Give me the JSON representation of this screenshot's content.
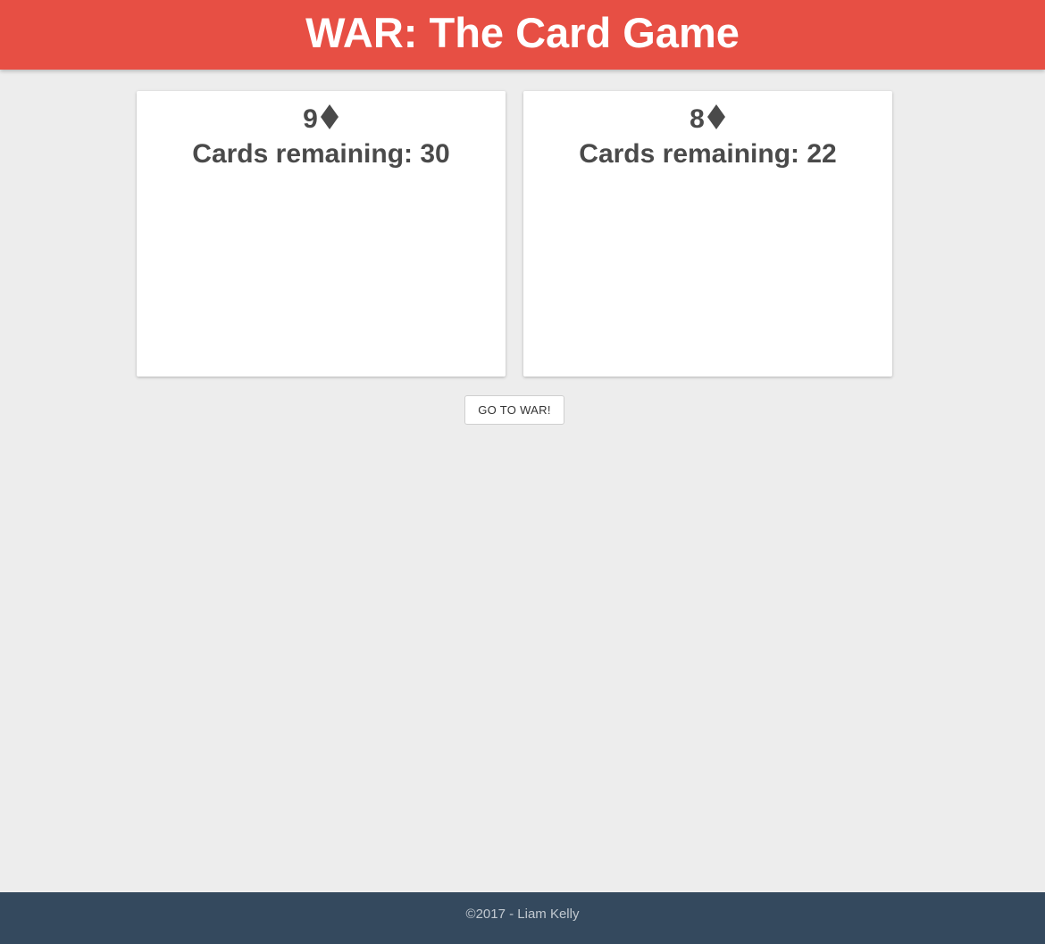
{
  "header": {
    "title": "WAR: The Card Game"
  },
  "players": [
    {
      "card_rank": "9",
      "card_suit": "diamond-icon",
      "remaining_text": "Cards remaining: 30"
    },
    {
      "card_rank": "8",
      "card_suit": "diamond-icon",
      "remaining_text": "Cards remaining: 22"
    }
  ],
  "actions": {
    "war_button_label": "GO TO WAR!"
  },
  "footer": {
    "copyright": "©2017 - Liam Kelly"
  },
  "colors": {
    "header_bg": "#e74f44",
    "footer_bg": "#34495e",
    "page_bg": "#ededed",
    "text": "#4a4a4a"
  }
}
